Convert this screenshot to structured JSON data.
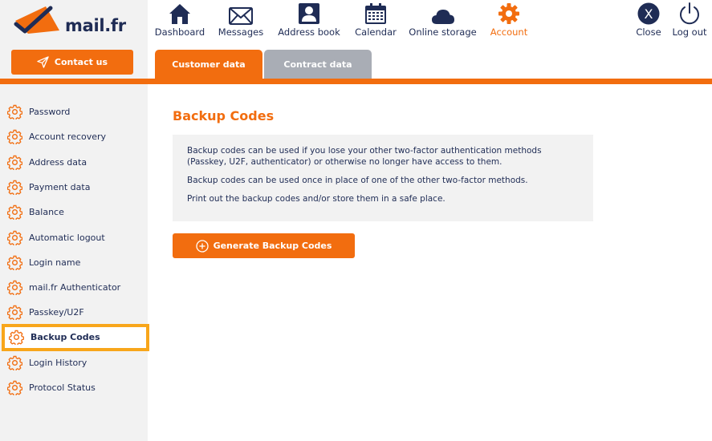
{
  "header": {
    "logo_text": "mail.fr",
    "contact_label": "Contact us"
  },
  "nav": [
    {
      "id": "dashboard",
      "label": "Dashboard",
      "icon": "home-icon"
    },
    {
      "id": "messages",
      "label": "Messages",
      "icon": "envelope-icon"
    },
    {
      "id": "address-book",
      "label": "Address book",
      "icon": "contact-card-icon"
    },
    {
      "id": "calendar",
      "label": "Calendar",
      "icon": "calendar-icon"
    },
    {
      "id": "online-storage",
      "label": "Online storage",
      "icon": "cloud-icon"
    },
    {
      "id": "account",
      "label": "Account",
      "icon": "gear-icon",
      "active": true
    },
    {
      "id": "close",
      "label": "Close",
      "icon": "close-circle-icon"
    },
    {
      "id": "logout",
      "label": "Log out",
      "icon": "power-icon"
    }
  ],
  "tabs": [
    {
      "label": "Customer data",
      "active": true
    },
    {
      "label": "Contract data",
      "active": false
    }
  ],
  "sidebar": {
    "items": [
      {
        "label": "Password"
      },
      {
        "label": "Account recovery"
      },
      {
        "label": "Address data"
      },
      {
        "label": "Payment data"
      },
      {
        "label": "Balance"
      },
      {
        "label": "Automatic logout"
      },
      {
        "label": "Login name"
      },
      {
        "label": "mail.fr Authenticator"
      },
      {
        "label": "Passkey/U2F"
      },
      {
        "label": "Backup Codes",
        "active": true
      },
      {
        "label": "Login History"
      },
      {
        "label": "Protocol Status"
      }
    ]
  },
  "main": {
    "title": "Backup Codes",
    "info": [
      "Backup codes can be used if you lose your other two-factor authentication methods (Passkey, U2F, authenticator) or otherwise no longer have access to them.",
      "Backup codes can be used once in place of one of the other two-factor methods.",
      "Print out the backup codes and/or store them in a safe place."
    ],
    "generate_label": "Generate Backup Codes"
  },
  "colors": {
    "accent": "#f26d0f",
    "navy": "#1f2c55",
    "highlight_border": "#f8a61b",
    "panel_bg": "#f2f2f2",
    "tab_inactive": "#a9adb5"
  }
}
